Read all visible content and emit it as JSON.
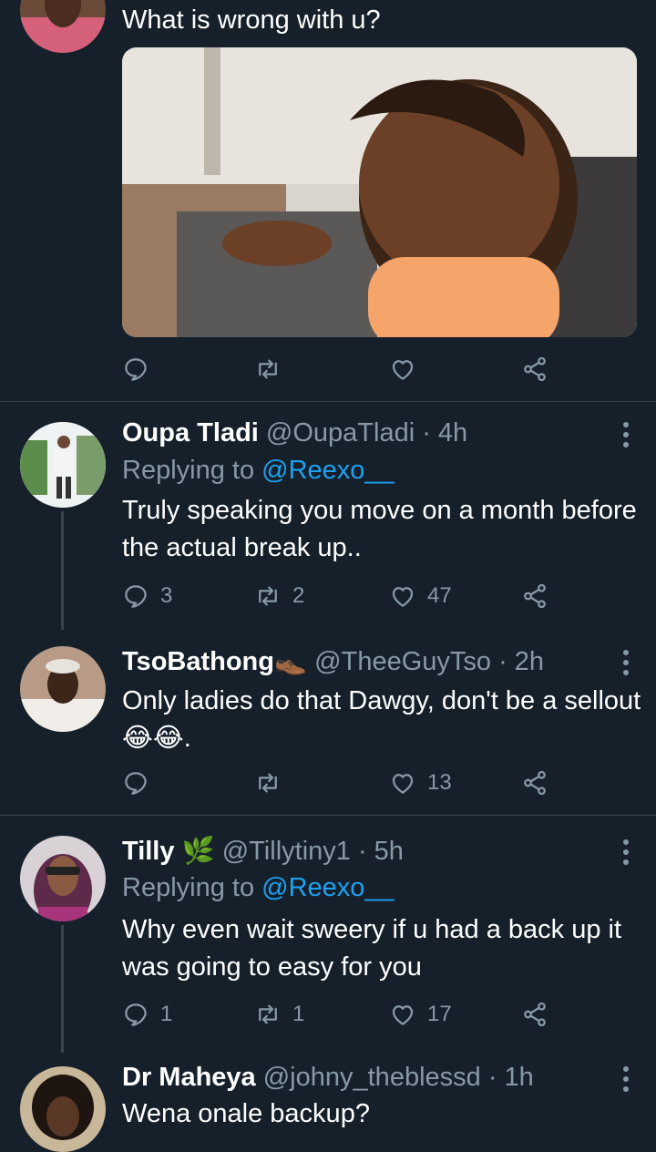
{
  "top_tweet": {
    "text": "What is wrong with u?"
  },
  "replies": [
    {
      "name": "Oupa Tladi",
      "handle": "@OupaTladi",
      "time": "· 4h",
      "replying_prefix": "Replying to ",
      "replying_to": "@Reexo__",
      "text": "Truly speaking you move on a month before the actual break up..",
      "counts": {
        "replies": "3",
        "retweets": "2",
        "likes": "47"
      }
    },
    {
      "name": "TsoBathong",
      "name_emoji": "👞",
      "handle": "@TheeGuyTso",
      "time": "· 2h",
      "text": "Only ladies do that Dawgy, don't be a sellout😂😂.",
      "counts": {
        "replies": "",
        "retweets": "",
        "likes": "13"
      }
    },
    {
      "name": "Tilly",
      "name_emoji": "🌿",
      "handle": "@Tillytiny1",
      "time": "· 5h",
      "replying_prefix": "Replying to ",
      "replying_to": "@Reexo__",
      "text": "Why even wait sweery if u had a back up it was going to easy for you",
      "counts": {
        "replies": "1",
        "retweets": "1",
        "likes": "17"
      }
    },
    {
      "name": "Dr Maheya",
      "handle": "@johny_theblessd",
      "time": "· 1h",
      "text": "Wena onale backup?"
    }
  ],
  "colors": {
    "background": "#15202b",
    "secondary_text": "#8899a6",
    "link": "#1da1f2",
    "divider": "#38444d"
  },
  "icons": [
    "reply-icon",
    "retweet-icon",
    "like-icon",
    "share-icon",
    "more-icon"
  ]
}
